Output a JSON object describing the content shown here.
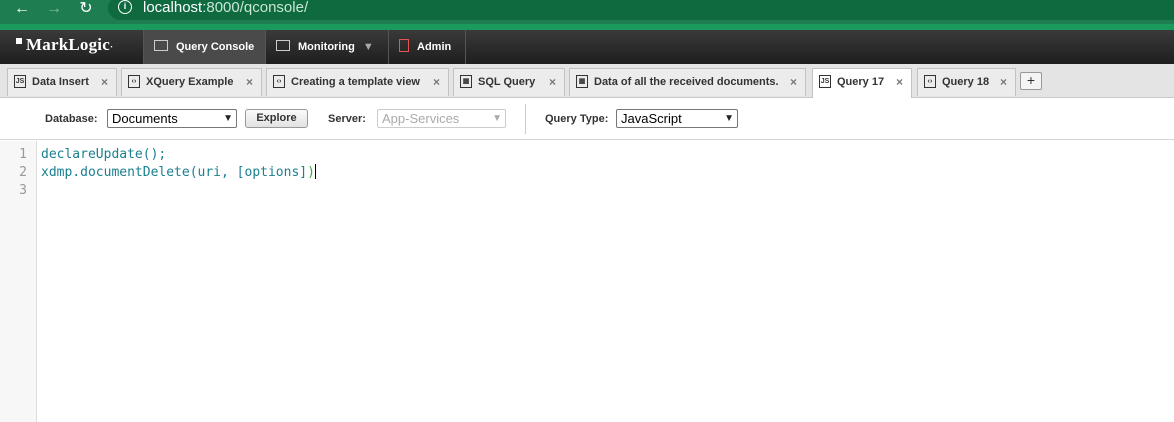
{
  "browser": {
    "url_host": "localhost",
    "url_rest": ":8000/qconsole/"
  },
  "app": {
    "logo": "MarkLogic",
    "nav": [
      {
        "label": "Query Console"
      },
      {
        "label": "Monitoring"
      },
      {
        "label": "Admin"
      }
    ]
  },
  "tabs": [
    {
      "label": "Data Insert",
      "type": "JS"
    },
    {
      "label": "XQuery Example",
      "type": "‹›"
    },
    {
      "label": "Creating a template view",
      "type": "‹›"
    },
    {
      "label": "SQL Query",
      "type": "table"
    },
    {
      "label": "Data of all the received documents.",
      "type": "table"
    },
    {
      "label": "Query 17",
      "type": "JS"
    },
    {
      "label": "Query 18",
      "type": "‹›"
    }
  ],
  "toolbar": {
    "database_label": "Database:",
    "database_value": "Documents",
    "explore_label": "Explore",
    "server_label": "Server:",
    "server_value": "App-Services",
    "query_type_label": "Query Type:",
    "query_type_value": "JavaScript"
  },
  "editor": {
    "line_numbers": [
      "1",
      "2",
      "3"
    ],
    "line1": "declareUpdate();",
    "line2_a": "xdmp.documentDelete(uri, [options]",
    "line2_b": ")"
  }
}
